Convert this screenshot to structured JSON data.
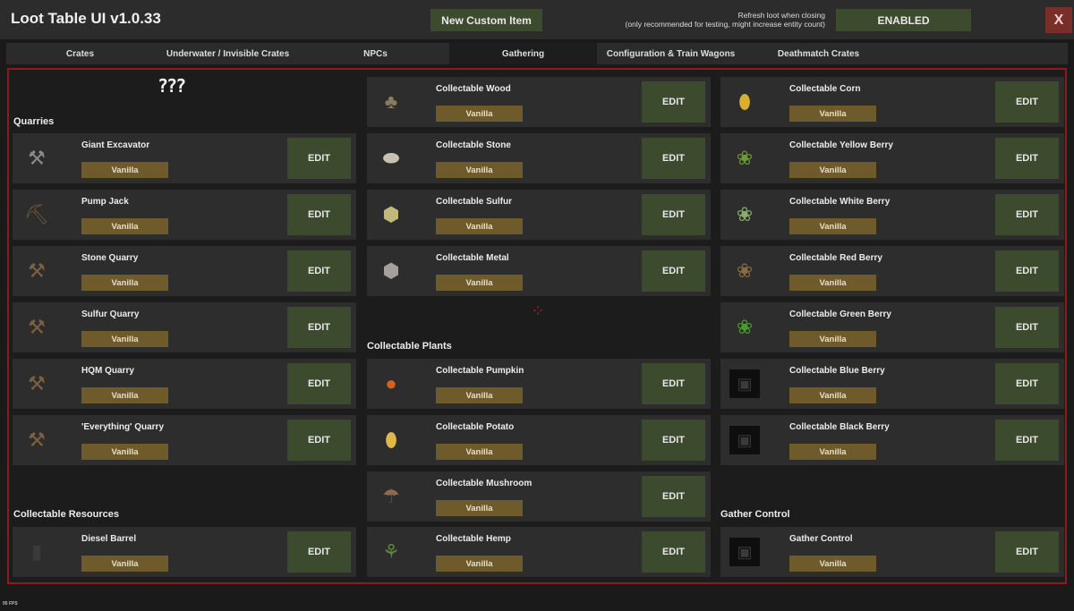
{
  "app": {
    "title": "Loot Table UI v1.0.33",
    "new_item_label": "New Custom Item",
    "refresh_note_line1": "Refresh loot when closing",
    "refresh_note_line2": "(only recommended for testing, might increase entity count)",
    "enabled_label": "ENABLED",
    "close_label": "X"
  },
  "tabs": [
    {
      "label": "Crates",
      "active": false
    },
    {
      "label": "Underwater / Invisible Crates",
      "active": false
    },
    {
      "label": "NPCs",
      "active": false
    },
    {
      "label": "Gathering",
      "active": true
    },
    {
      "label": "Configuration & Train Wagons",
      "active": false
    },
    {
      "label": "Deathmatch Crates",
      "active": false
    }
  ],
  "placeholder_mark": "???",
  "sections": {
    "quarries": "Quarries",
    "resources": "Collectable Resources",
    "plants": "Collectable Plants",
    "gather": "Gather Control"
  },
  "edit_label": "EDIT",
  "badge_label": "Vanilla",
  "quarries": [
    {
      "name": "Giant Excavator",
      "icon": "excavator-icon"
    },
    {
      "name": "Pump Jack",
      "icon": "pump-jack-icon"
    },
    {
      "name": "Stone Quarry",
      "icon": "quarry-icon"
    },
    {
      "name": "Sulfur Quarry",
      "icon": "quarry-icon"
    },
    {
      "name": "HQM Quarry",
      "icon": "quarry-icon"
    },
    {
      "name": "'Everything' Quarry",
      "icon": "quarry-icon"
    }
  ],
  "resources_left": [
    {
      "name": "Diesel Barrel",
      "icon": "diesel-barrel-icon"
    }
  ],
  "resources_middle": [
    {
      "name": "Collectable Wood",
      "icon": "wood-stump-icon"
    },
    {
      "name": "Collectable Stone",
      "icon": "stone-icon"
    },
    {
      "name": "Collectable Sulfur",
      "icon": "sulfur-ore-icon"
    },
    {
      "name": "Collectable Metal",
      "icon": "metal-ore-icon"
    }
  ],
  "plants": [
    {
      "name": "Collectable Pumpkin",
      "icon": "pumpkin-icon"
    },
    {
      "name": "Collectable Potato",
      "icon": "potato-icon"
    },
    {
      "name": "Collectable Mushroom",
      "icon": "mushroom-icon"
    },
    {
      "name": "Collectable Hemp",
      "icon": "hemp-icon"
    }
  ],
  "right": [
    {
      "name": "Collectable Corn",
      "icon": "corn-icon"
    },
    {
      "name": "Collectable Yellow Berry",
      "icon": "yellow-berry-icon"
    },
    {
      "name": "Collectable White Berry",
      "icon": "white-berry-icon"
    },
    {
      "name": "Collectable Red Berry",
      "icon": "red-berry-icon"
    },
    {
      "name": "Collectable Green Berry",
      "icon": "green-berry-icon"
    },
    {
      "name": "Collectable Blue Berry",
      "icon": "missing-texture-icon"
    },
    {
      "name": "Collectable Black Berry",
      "icon": "missing-texture-icon"
    }
  ],
  "gather_control": [
    {
      "name": "Gather Control",
      "icon": "missing-texture-icon"
    }
  ],
  "fps": "95 FPS",
  "colors": {
    "accent_green": "#3c4a2e",
    "badge_gold": "#6f5a2b",
    "panel_border": "#8c1a22",
    "close_red": "#7a2e2a"
  }
}
